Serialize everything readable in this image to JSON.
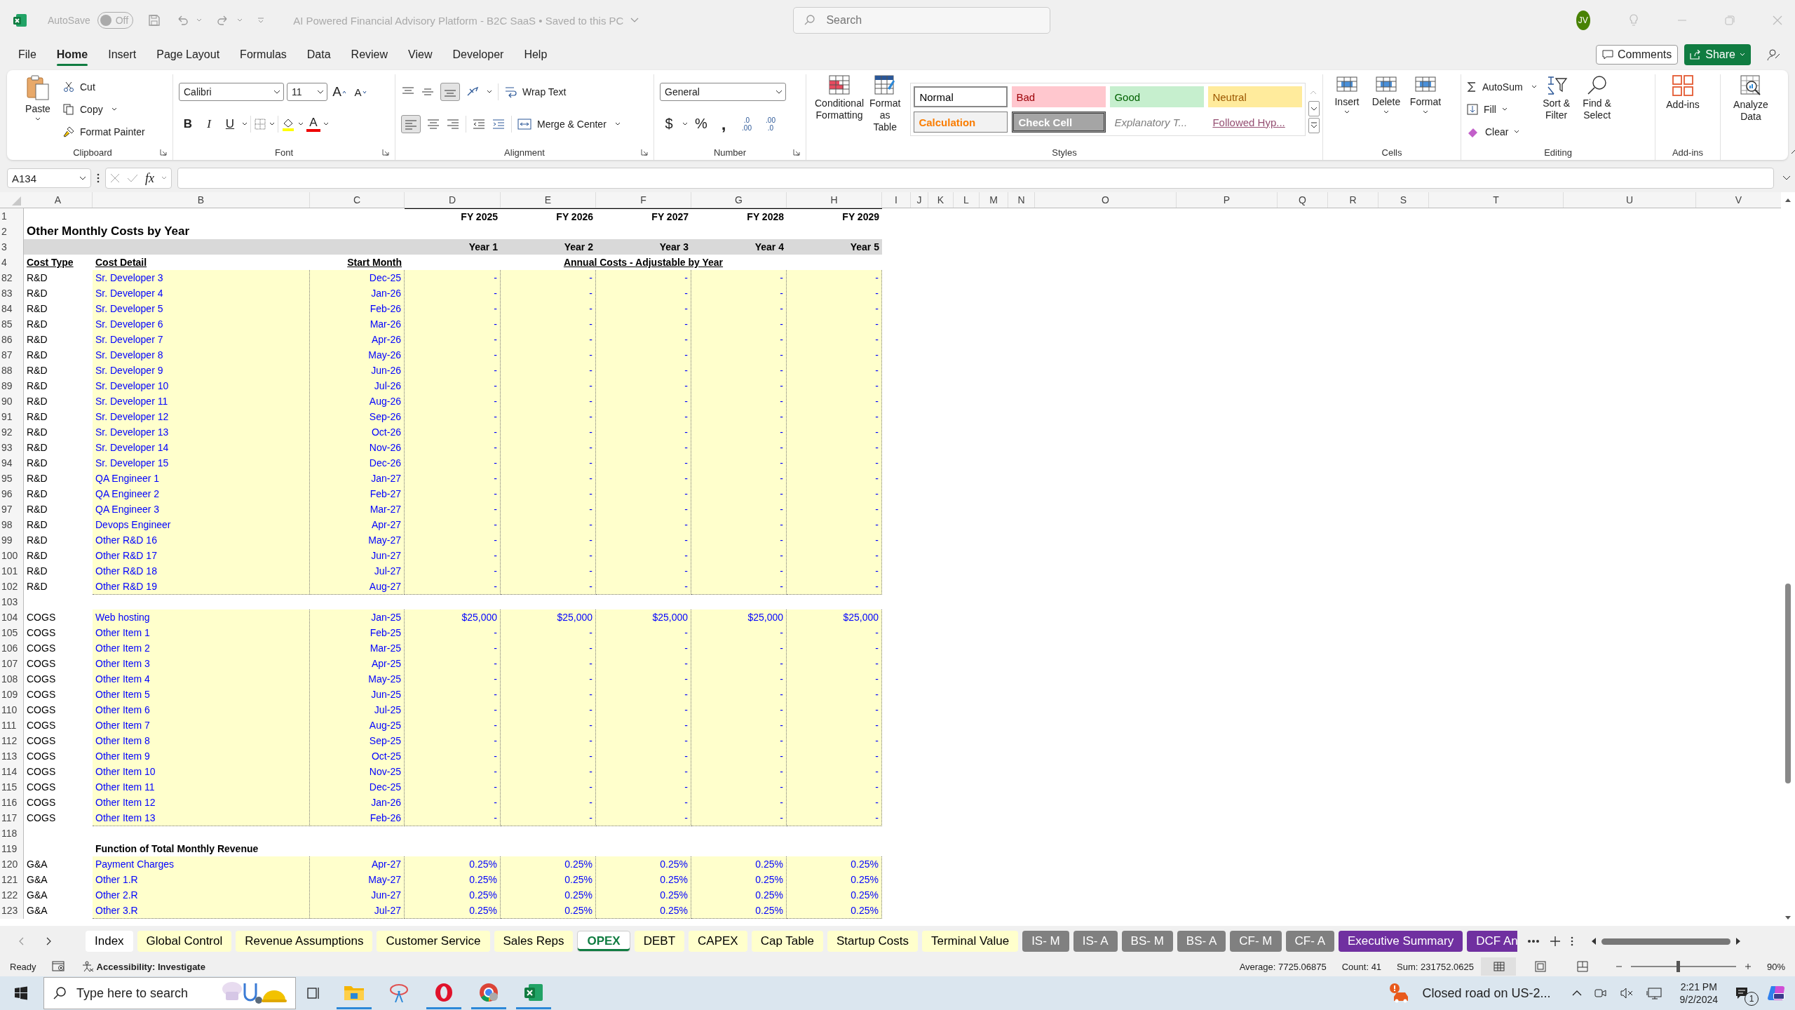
{
  "title_bar": {
    "autosave_label": "AutoSave",
    "autosave": {
      "on": false,
      "label": "Off"
    },
    "document_title": "AI Powered Financial Advisory Platform - B2C SaaS • Saved to this PC",
    "search_placeholder": "Search",
    "avatar": "JV"
  },
  "menu_tabs": [
    {
      "label": "File",
      "selected": false
    },
    {
      "label": "Home",
      "selected": true
    },
    {
      "label": "Insert",
      "selected": false
    },
    {
      "label": "Page Layout",
      "selected": false
    },
    {
      "label": "Formulas",
      "selected": false
    },
    {
      "label": "Data",
      "selected": false
    },
    {
      "label": "Review",
      "selected": false
    },
    {
      "label": "View",
      "selected": false
    },
    {
      "label": "Developer",
      "selected": false
    },
    {
      "label": "Help",
      "selected": false
    }
  ],
  "comments_button": "Comments",
  "share_button": "Share",
  "ribbon": {
    "clipboard": {
      "paste": "Paste",
      "cut": "Cut",
      "copy": "Copy",
      "format_painter": "Format Painter",
      "label": "Clipboard"
    },
    "font": {
      "name": "Calibri",
      "size": "11",
      "grow": "A",
      "shrink": "A",
      "bold": "B",
      "italic": "I",
      "underline": "U",
      "font_color": "A",
      "label": "Font"
    },
    "alignment": {
      "wrap_text": "Wrap Text",
      "merge_center": "Merge & Center",
      "label": "Alignment"
    },
    "number": {
      "format": "General",
      "currency": "$",
      "percent": "%",
      "comma": ",",
      "increase_decimal": {
        "top": ".0",
        "bottom": ".00"
      },
      "decrease_decimal": {
        "top": ".00",
        "bottom": ".0"
      },
      "label": "Number"
    },
    "conditional_formatting": "Conditional Formatting",
    "format_as_table": "Format as Table",
    "styles": [
      {
        "label": "Normal",
        "kind": "normal"
      },
      {
        "label": "Bad",
        "kind": "bad"
      },
      {
        "label": "Good",
        "kind": "good"
      },
      {
        "label": "Neutral",
        "kind": "neutral"
      },
      {
        "label": "Calculation",
        "kind": "calculation"
      },
      {
        "label": "Check Cell",
        "kind": "check"
      },
      {
        "label": "Explanatory T...",
        "kind": "explanatory"
      },
      {
        "label": "Followed Hyp...",
        "kind": "followed"
      }
    ],
    "styles_label": "Styles",
    "cells": [
      "Insert",
      "Delete",
      "Format"
    ],
    "cells_label": "Cells",
    "editing": {
      "autosum": "AutoSum",
      "fill": "Fill",
      "clear": "Clear",
      "sort_filter": "Sort & Filter",
      "find_select": "Find & Select",
      "label": "Editing"
    },
    "add_ins": "Add-ins",
    "add_ins_label": "Add-ins",
    "analyze_data": "Analyze Data"
  },
  "formula_bar": {
    "name_box": "A134",
    "fx": "fx"
  },
  "sheet": {
    "column_headers": [
      "A",
      "B",
      "C",
      "D",
      "E",
      "F",
      "G",
      "H",
      "I",
      "J",
      "K",
      "L",
      "M",
      "N",
      "O",
      "P",
      "Q",
      "R",
      "S",
      "T",
      "U",
      "V"
    ],
    "header_row_numbers": [
      "1",
      "2",
      "3",
      "4"
    ],
    "fiscal_years": [
      "FY 2025",
      "FY 2026",
      "FY 2027",
      "FY 2028",
      "FY 2029"
    ],
    "title": "Other Monthly Costs by Year",
    "years": [
      "Year 1",
      "Year 2",
      "Year 3",
      "Year 4",
      "Year 5"
    ],
    "labels": {
      "cost_type": "Cost Type",
      "cost_detail": "Cost Detail",
      "start_month": "Start Month",
      "annual_costs": "Annual Costs - Adjustable by Year"
    },
    "rows": [
      {
        "row": "82",
        "kind": "data",
        "cost_type": "R&D",
        "cost_detail": "Sr. Developer 3",
        "start_month": "Dec-25",
        "values": [
          "-",
          "-",
          "-",
          "-",
          "-"
        ]
      },
      {
        "row": "83",
        "kind": "data",
        "cost_type": "R&D",
        "cost_detail": "Sr. Developer 4",
        "start_month": "Jan-26",
        "values": [
          "-",
          "-",
          "-",
          "-",
          "-"
        ]
      },
      {
        "row": "84",
        "kind": "data",
        "cost_type": "R&D",
        "cost_detail": "Sr. Developer 5",
        "start_month": "Feb-26",
        "values": [
          "-",
          "-",
          "-",
          "-",
          "-"
        ]
      },
      {
        "row": "85",
        "kind": "data",
        "cost_type": "R&D",
        "cost_detail": "Sr. Developer 6",
        "start_month": "Mar-26",
        "values": [
          "-",
          "-",
          "-",
          "-",
          "-"
        ]
      },
      {
        "row": "86",
        "kind": "data",
        "cost_type": "R&D",
        "cost_detail": "Sr. Developer 7",
        "start_month": "Apr-26",
        "values": [
          "-",
          "-",
          "-",
          "-",
          "-"
        ]
      },
      {
        "row": "87",
        "kind": "data",
        "cost_type": "R&D",
        "cost_detail": "Sr. Developer 8",
        "start_month": "May-26",
        "values": [
          "-",
          "-",
          "-",
          "-",
          "-"
        ]
      },
      {
        "row": "88",
        "kind": "data",
        "cost_type": "R&D",
        "cost_detail": "Sr. Developer 9",
        "start_month": "Jun-26",
        "values": [
          "-",
          "-",
          "-",
          "-",
          "-"
        ]
      },
      {
        "row": "89",
        "kind": "data",
        "cost_type": "R&D",
        "cost_detail": "Sr. Developer 10",
        "start_month": "Jul-26",
        "values": [
          "-",
          "-",
          "-",
          "-",
          "-"
        ]
      },
      {
        "row": "90",
        "kind": "data",
        "cost_type": "R&D",
        "cost_detail": "Sr. Developer 11",
        "start_month": "Aug-26",
        "values": [
          "-",
          "-",
          "-",
          "-",
          "-"
        ]
      },
      {
        "row": "91",
        "kind": "data",
        "cost_type": "R&D",
        "cost_detail": "Sr. Developer 12",
        "start_month": "Sep-26",
        "values": [
          "-",
          "-",
          "-",
          "-",
          "-"
        ]
      },
      {
        "row": "92",
        "kind": "data",
        "cost_type": "R&D",
        "cost_detail": "Sr. Developer 13",
        "start_month": "Oct-26",
        "values": [
          "-",
          "-",
          "-",
          "-",
          "-"
        ]
      },
      {
        "row": "93",
        "kind": "data",
        "cost_type": "R&D",
        "cost_detail": "Sr. Developer 14",
        "start_month": "Nov-26",
        "values": [
          "-",
          "-",
          "-",
          "-",
          "-"
        ]
      },
      {
        "row": "94",
        "kind": "data",
        "cost_type": "R&D",
        "cost_detail": "Sr. Developer 15",
        "start_month": "Dec-26",
        "values": [
          "-",
          "-",
          "-",
          "-",
          "-"
        ]
      },
      {
        "row": "95",
        "kind": "data",
        "cost_type": "R&D",
        "cost_detail": "QA Engineer 1",
        "start_month": "Jan-27",
        "values": [
          "-",
          "-",
          "-",
          "-",
          "-"
        ]
      },
      {
        "row": "96",
        "kind": "data",
        "cost_type": "R&D",
        "cost_detail": "QA Engineer 2",
        "start_month": "Feb-27",
        "values": [
          "-",
          "-",
          "-",
          "-",
          "-"
        ]
      },
      {
        "row": "97",
        "kind": "data",
        "cost_type": "R&D",
        "cost_detail": "QA Engineer 3",
        "start_month": "Mar-27",
        "values": [
          "-",
          "-",
          "-",
          "-",
          "-"
        ]
      },
      {
        "row": "98",
        "kind": "data",
        "cost_type": "R&D",
        "cost_detail": "Devops Engineer",
        "start_month": "Apr-27",
        "values": [
          "-",
          "-",
          "-",
          "-",
          "-"
        ]
      },
      {
        "row": "99",
        "kind": "data",
        "cost_type": "R&D",
        "cost_detail": "Other R&D 16",
        "start_month": "May-27",
        "values": [
          "-",
          "-",
          "-",
          "-",
          "-"
        ]
      },
      {
        "row": "100",
        "kind": "data",
        "cost_type": "R&D",
        "cost_detail": "Other R&D 17",
        "start_month": "Jun-27",
        "values": [
          "-",
          "-",
          "-",
          "-",
          "-"
        ]
      },
      {
        "row": "101",
        "kind": "data",
        "cost_type": "R&D",
        "cost_detail": "Other R&D 18",
        "start_month": "Jul-27",
        "values": [
          "-",
          "-",
          "-",
          "-",
          "-"
        ]
      },
      {
        "row": "102",
        "kind": "data",
        "cost_type": "R&D",
        "cost_detail": "Other R&D 19",
        "start_month": "Aug-27",
        "values": [
          "-",
          "-",
          "-",
          "-",
          "-"
        ]
      },
      {
        "row": "103",
        "kind": "blank"
      },
      {
        "row": "104",
        "kind": "data",
        "cost_type": "COGS",
        "cost_detail": "Web hosting",
        "start_month": "Jan-25",
        "values": [
          "$25,000",
          "$25,000",
          "$25,000",
          "$25,000",
          "$25,000"
        ]
      },
      {
        "row": "105",
        "kind": "data",
        "cost_type": "COGS",
        "cost_detail": "Other Item 1",
        "start_month": "Feb-25",
        "values": [
          "-",
          "-",
          "-",
          "-",
          "-"
        ]
      },
      {
        "row": "106",
        "kind": "data",
        "cost_type": "COGS",
        "cost_detail": "Other Item 2",
        "start_month": "Mar-25",
        "values": [
          "-",
          "-",
          "-",
          "-",
          "-"
        ]
      },
      {
        "row": "107",
        "kind": "data",
        "cost_type": "COGS",
        "cost_detail": "Other Item 3",
        "start_month": "Apr-25",
        "values": [
          "-",
          "-",
          "-",
          "-",
          "-"
        ]
      },
      {
        "row": "108",
        "kind": "data",
        "cost_type": "COGS",
        "cost_detail": "Other Item 4",
        "start_month": "May-25",
        "values": [
          "-",
          "-",
          "-",
          "-",
          "-"
        ]
      },
      {
        "row": "109",
        "kind": "data",
        "cost_type": "COGS",
        "cost_detail": "Other Item 5",
        "start_month": "Jun-25",
        "values": [
          "-",
          "-",
          "-",
          "-",
          "-"
        ]
      },
      {
        "row": "110",
        "kind": "data",
        "cost_type": "COGS",
        "cost_detail": "Other Item 6",
        "start_month": "Jul-25",
        "values": [
          "-",
          "-",
          "-",
          "-",
          "-"
        ]
      },
      {
        "row": "111",
        "kind": "data",
        "cost_type": "COGS",
        "cost_detail": "Other Item 7",
        "start_month": "Aug-25",
        "values": [
          "-",
          "-",
          "-",
          "-",
          "-"
        ]
      },
      {
        "row": "112",
        "kind": "data",
        "cost_type": "COGS",
        "cost_detail": "Other Item 8",
        "start_month": "Sep-25",
        "values": [
          "-",
          "-",
          "-",
          "-",
          "-"
        ]
      },
      {
        "row": "113",
        "kind": "data",
        "cost_type": "COGS",
        "cost_detail": "Other Item 9",
        "start_month": "Oct-25",
        "values": [
          "-",
          "-",
          "-",
          "-",
          "-"
        ]
      },
      {
        "row": "114",
        "kind": "data",
        "cost_type": "COGS",
        "cost_detail": "Other Item 10",
        "start_month": "Nov-25",
        "values": [
          "-",
          "-",
          "-",
          "-",
          "-"
        ]
      },
      {
        "row": "115",
        "kind": "data",
        "cost_type": "COGS",
        "cost_detail": "Other Item 11",
        "start_month": "Dec-25",
        "values": [
          "-",
          "-",
          "-",
          "-",
          "-"
        ]
      },
      {
        "row": "116",
        "kind": "data",
        "cost_type": "COGS",
        "cost_detail": "Other Item 12",
        "start_month": "Jan-26",
        "values": [
          "-",
          "-",
          "-",
          "-",
          "-"
        ]
      },
      {
        "row": "117",
        "kind": "data",
        "cost_type": "COGS",
        "cost_detail": "Other Item 13",
        "start_month": "Feb-26",
        "values": [
          "-",
          "-",
          "-",
          "-",
          "-"
        ]
      },
      {
        "row": "118",
        "kind": "blank"
      },
      {
        "row": "119",
        "kind": "section",
        "label": "Function of Total Monthly Revenue"
      },
      {
        "row": "120",
        "kind": "data",
        "cost_type": "G&A",
        "cost_detail": "Payment Charges",
        "start_month": "Apr-27",
        "values": [
          "0.25%",
          "0.25%",
          "0.25%",
          "0.25%",
          "0.25%"
        ]
      },
      {
        "row": "121",
        "kind": "data",
        "cost_type": "G&A",
        "cost_detail": "Other 1.R",
        "start_month": "May-27",
        "values": [
          "0.25%",
          "0.25%",
          "0.25%",
          "0.25%",
          "0.25%"
        ]
      },
      {
        "row": "122",
        "kind": "data",
        "cost_type": "G&A",
        "cost_detail": "Other 2.R",
        "start_month": "Jun-27",
        "values": [
          "0.25%",
          "0.25%",
          "0.25%",
          "0.25%",
          "0.25%"
        ]
      },
      {
        "row": "123",
        "kind": "data",
        "cost_type": "G&A",
        "cost_detail": "Other 3.R",
        "start_month": "Jul-27",
        "values": [
          "0.25%",
          "0.25%",
          "0.25%",
          "0.25%",
          "0.25%"
        ]
      }
    ]
  },
  "sheet_tabs": [
    {
      "label": "Index",
      "selected": false,
      "color": "#ffffff"
    },
    {
      "label": "Global Control",
      "selected": false,
      "color": "#ffffcc"
    },
    {
      "label": "Revenue Assumptions",
      "selected": false,
      "color": "#ffffcc"
    },
    {
      "label": "Customer Service",
      "selected": false,
      "color": "#ffffcc"
    },
    {
      "label": "Sales Reps",
      "selected": false,
      "color": "#ffffcc"
    },
    {
      "label": "OPEX",
      "selected": true
    },
    {
      "label": "DEBT",
      "selected": false,
      "color": "#ffffcc"
    },
    {
      "label": "CAPEX",
      "selected": false,
      "color": "#ffffcc"
    },
    {
      "label": "Cap Table",
      "selected": false,
      "color": "#ffffcc"
    },
    {
      "label": "Startup Costs",
      "selected": false,
      "color": "#ffffcc"
    },
    {
      "label": "Terminal Value",
      "selected": false,
      "color": "#ffffcc"
    },
    {
      "label": "IS- M",
      "selected": false,
      "color": "#808080"
    },
    {
      "label": "IS- A",
      "selected": false,
      "color": "#808080"
    },
    {
      "label": "BS- M",
      "selected": false,
      "color": "#808080"
    },
    {
      "label": "BS- A",
      "selected": false,
      "color": "#808080"
    },
    {
      "label": "CF- M",
      "selected": false,
      "color": "#808080"
    },
    {
      "label": "CF- A",
      "selected": false,
      "color": "#808080"
    },
    {
      "label": "Executive Summary",
      "selected": false,
      "color": "#7030a0"
    },
    {
      "label": "DCF An",
      "selected": false,
      "color": "#7030a0"
    }
  ],
  "status_bar": {
    "ready": "Ready",
    "accessibility": "Accessibility: Investigate",
    "average": "Average: 7725.06875",
    "count": "Count: 41",
    "sum": "Sum: 231752.0625",
    "zoom": {
      "level": 0.45,
      "reading": "90%"
    }
  },
  "taskbar": {
    "search_placeholder": "Type here to search",
    "news": "Closed road on US-2...",
    "time": "2:21 PM",
    "date": "9/2/2024",
    "notifications": "1"
  }
}
